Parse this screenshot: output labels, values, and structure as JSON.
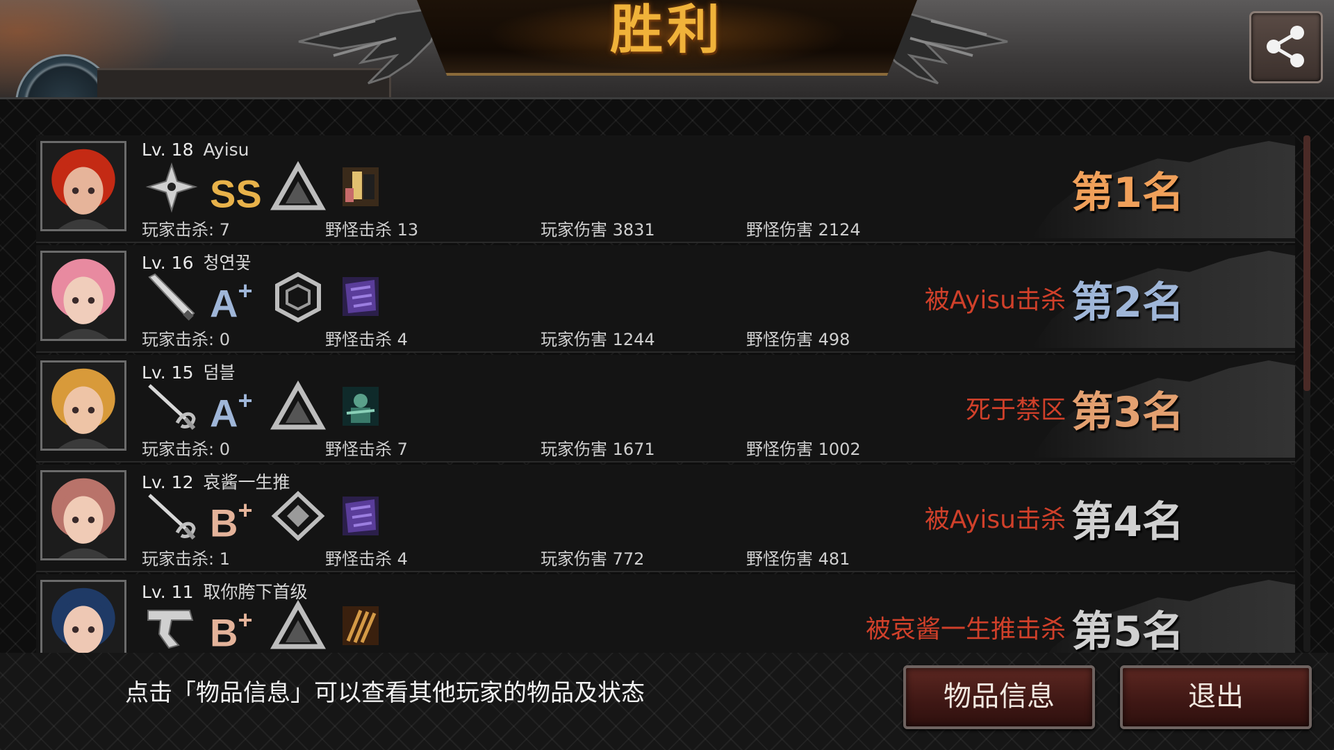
{
  "header": {
    "title": "胜利",
    "share_icon": "share-icon"
  },
  "players": [
    {
      "level": "Lv. 18",
      "name": "Ayisu",
      "weapon_icon": "shuriken-icon",
      "grade": "SS",
      "grade_plus": "",
      "grade_color": "#e8b24a",
      "gear_icon": "triangle-icon",
      "monster_icon": "portrait-icon",
      "player_kills": "玩家击杀: 7",
      "monster_kills": "野怪击杀 13",
      "player_damage": "玩家伤害 3831",
      "monster_damage": "野怪伤害 2124",
      "fate": "",
      "rank": "第1名",
      "rank_color": "#f0a05a",
      "portrait_hair": "#c42a14",
      "portrait_skin": "#e6b49a"
    },
    {
      "level": "Lv. 16",
      "name": "청연꽃",
      "weapon_icon": "bat-icon",
      "grade": "A",
      "grade_plus": "+",
      "grade_color": "#9fb6d8",
      "gear_icon": "hexagon-icon",
      "monster_icon": "creature-icon",
      "player_kills": "玩家击杀: 0",
      "monster_kills": "野怪击杀 4",
      "player_damage": "玩家伤害 1244",
      "monster_damage": "野怪伤害 498",
      "fate": "被Ayisu击杀",
      "rank": "第2名",
      "rank_color": "#9fb6d8",
      "portrait_hair": "#e88aa0",
      "portrait_skin": "#f0cdbb"
    },
    {
      "level": "Lv. 15",
      "name": "덤블",
      "weapon_icon": "rapier-icon",
      "grade": "A",
      "grade_plus": "+",
      "grade_color": "#9fb6d8",
      "gear_icon": "triangle-icon",
      "monster_icon": "soldier-icon",
      "player_kills": "玩家击杀: 0",
      "monster_kills": "野怪击杀 7",
      "player_damage": "玩家伤害 1671",
      "monster_damage": "野怪伤害 1002",
      "fate": "死于禁区",
      "rank": "第3名",
      "rank_color": "#e3a070",
      "portrait_hair": "#d89a3a",
      "portrait_skin": "#eec4a6"
    },
    {
      "level": "Lv. 12",
      "name": "哀酱一生推",
      "weapon_icon": "rapier-icon",
      "grade": "B",
      "grade_plus": "+",
      "grade_color": "#e4b39a",
      "gear_icon": "diamond-icon",
      "monster_icon": "creature-icon",
      "player_kills": "玩家击杀: 1",
      "monster_kills": "野怪击杀 4",
      "player_damage": "玩家伤害 772",
      "monster_damage": "野怪伤害 481",
      "fate": "被Ayisu击杀",
      "rank": "第4名",
      "rank_color": "#d0d0d0",
      "portrait_hair": "#b9736a",
      "portrait_skin": "#f0cbb6"
    },
    {
      "level": "Lv. 11",
      "name": "取你胯下首级",
      "weapon_icon": "pistol-icon",
      "grade": "B",
      "grade_plus": "+",
      "grade_color": "#e4b39a",
      "gear_icon": "triangle-icon",
      "monster_icon": "claw-icon",
      "player_kills": "",
      "monster_kills": "",
      "player_damage": "",
      "monster_damage": "",
      "fate": "被哀酱一生推击杀",
      "rank": "第5名",
      "rank_color": "#d0d0d0",
      "portrait_hair": "#1f3a66",
      "portrait_skin": "#eec8b4"
    }
  ],
  "footer": {
    "hint": "点击「物品信息」可以查看其他玩家的物品及状态",
    "items_button": "物品信息",
    "exit_button": "退出"
  }
}
